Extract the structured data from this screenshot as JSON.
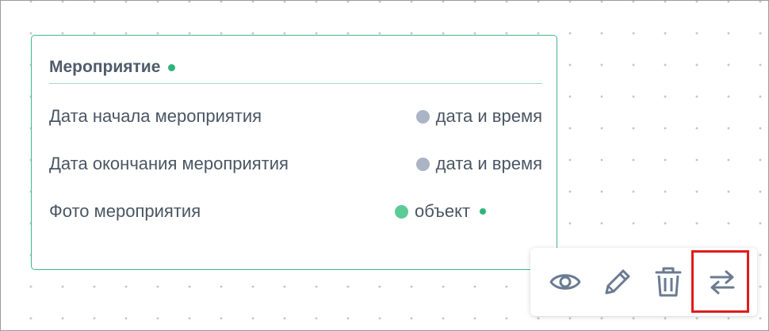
{
  "entity": {
    "title": "Мероприятие",
    "fields": [
      {
        "name": "Дата начала мероприятия",
        "type": "дата и время",
        "type_color": "gray",
        "required": false
      },
      {
        "name": "Дата окончания мероприятия",
        "type": "дата и время",
        "type_color": "gray",
        "required": false
      },
      {
        "name": "Фото мероприятия",
        "type": "объект",
        "type_color": "green",
        "required": true
      }
    ]
  },
  "toolbar": {
    "icons": [
      "eye-icon",
      "pencil-icon",
      "trash-icon",
      "swap-arrows-icon"
    ]
  },
  "colors": {
    "accent": "#2fb47c",
    "card_border": "#3fb88a",
    "icon": "#6b7b90",
    "highlight": "#e11b1b"
  }
}
